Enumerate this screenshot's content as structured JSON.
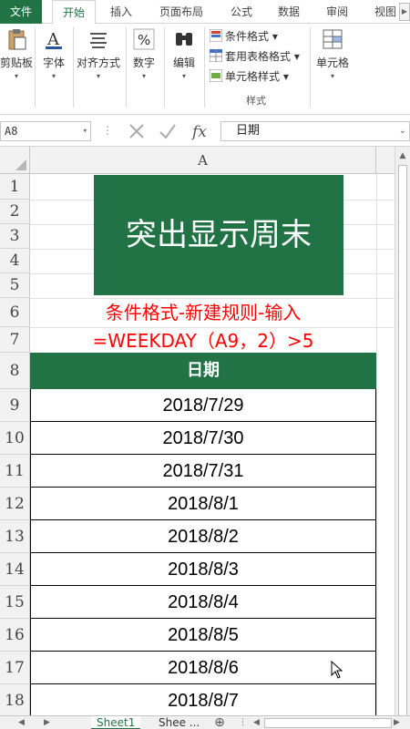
{
  "tabs": [
    {
      "label": "文件"
    },
    {
      "label": "开始"
    },
    {
      "label": "插入"
    },
    {
      "label": "页面布局"
    },
    {
      "label": "公式"
    },
    {
      "label": "数据"
    },
    {
      "label": "审阅"
    },
    {
      "label": "视图"
    }
  ],
  "ribbon": {
    "clipboard": "剪贴板",
    "font": "字体",
    "alignment": "对齐方式",
    "number": "数字",
    "editing": "编辑",
    "conditional_format": "条件格式",
    "table_format": "套用表格格式",
    "cell_style": "单元格样式",
    "styles_group": "样式",
    "cells": "单元格"
  },
  "formula_bar": {
    "name_box": "A8",
    "value": "日期"
  },
  "grid": {
    "column_header": "A",
    "rows": [
      "1",
      "2",
      "3",
      "4",
      "5",
      "6",
      "7",
      "8",
      "9",
      "10",
      "11",
      "12",
      "13",
      "14",
      "15",
      "16",
      "17",
      "18"
    ],
    "title": "突出显示周末",
    "instruction_line1": "条件格式-新建规则-输入",
    "instruction_line2": "=WEEKDAY（A9，2）>5",
    "date_header": "日期",
    "dates": [
      "2018/7/29",
      "2018/7/30",
      "2018/7/31",
      "2018/8/1",
      "2018/8/2",
      "2018/8/3",
      "2018/8/4",
      "2018/8/5",
      "2018/8/6",
      "2018/8/7"
    ]
  },
  "sheets": {
    "active": "Sheet1",
    "second": "Shee ..."
  },
  "colors": {
    "excel_green": "#217346",
    "instruction_red": "#ff0000"
  }
}
